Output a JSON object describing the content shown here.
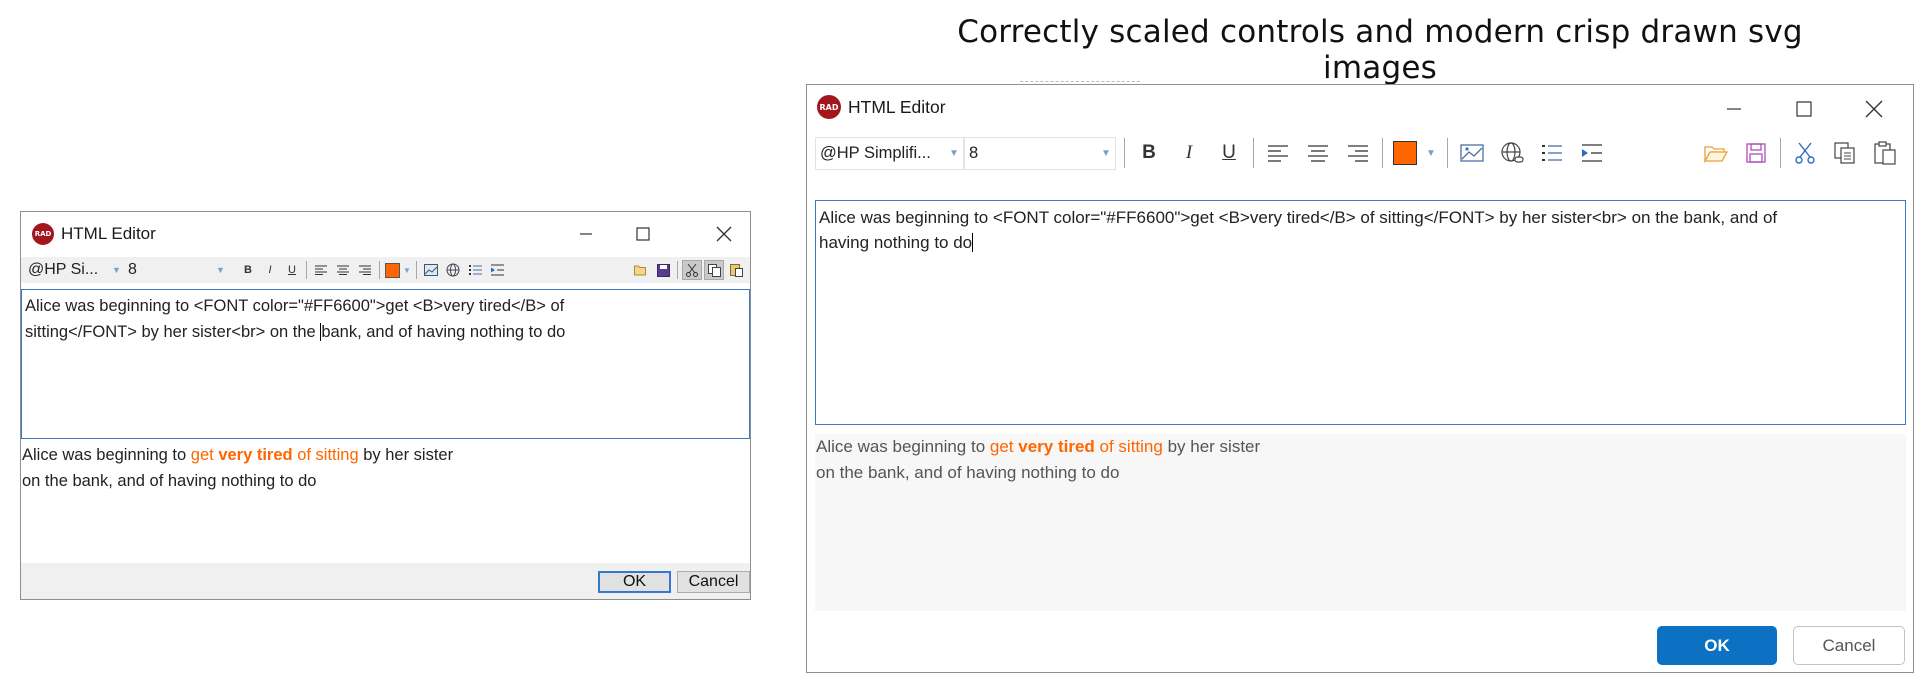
{
  "caption": "Correctly scaled controls and modern crisp drawn svg images",
  "colors": {
    "accent": "#ff6600",
    "logo": "#a3161d",
    "primary_button": "#0c71c3",
    "focus_border": "#3b78c8"
  },
  "small_window": {
    "logo": "RAD",
    "title": "HTML Editor",
    "font_family": "@HP Si...",
    "font_size": "8",
    "editor_lines": [
      {
        "before_caret": "Alice was beginning to <FONT color=\"#FF6600\">get <B>very tired</B> of",
        "after_caret": ""
      },
      {
        "before_caret": "sitting</FONT> by her sister<br> on the ",
        "after_caret": "bank, and of having nothing to do"
      }
    ],
    "preview": {
      "line1_plain": "Alice was beginning to ",
      "line1_orange": "get ",
      "line1_bold_orange": "very tired",
      "line1_orange2": " of sitting",
      "line1_rest": " by her sister",
      "line2": "on the bank, and of having nothing to do"
    },
    "ok_label": "OK",
    "cancel_label": "Cancel"
  },
  "large_window": {
    "logo": "RAD",
    "title": "HTML Editor",
    "font_family": "@HP Simplifi...",
    "font_size": "8",
    "editor_lines": [
      {
        "before_caret": "Alice was beginning to <FONT color=\"#FF6600\">get <B>very tired</B> of sitting</FONT> by her sister<br> on the bank, and of",
        "after_caret": ""
      },
      {
        "before_caret": "having nothing to do",
        "after_caret": ""
      }
    ],
    "preview": {
      "line1_plain": "Alice was beginning to ",
      "line1_orange": "get ",
      "line1_bold_orange": "very tired",
      "line1_orange2": " of sitting",
      "line1_rest": " by her sister",
      "line2": "on the bank, and of having nothing to do"
    },
    "ok_label": "OK",
    "cancel_label": "Cancel"
  },
  "toolbar_icons": [
    "bold-icon",
    "italic-icon",
    "underline-icon",
    "align-left-icon",
    "align-center-icon",
    "align-right-icon",
    "font-color-icon",
    "insert-image-icon",
    "insert-link-icon",
    "numbered-list-icon",
    "indent-icon",
    "open-icon",
    "save-icon",
    "cut-icon",
    "copy-icon",
    "paste-icon"
  ]
}
